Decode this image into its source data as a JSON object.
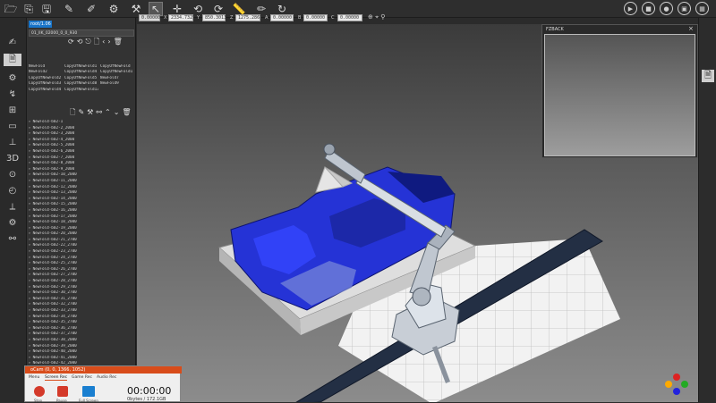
{
  "toolbar": {
    "left_icons": [
      "folder-icon",
      "open-icon",
      "save-icon",
      "tool-edit-icon",
      "tool-teach-icon",
      "robot-link-icon",
      "robot-joint-icon",
      "pointer-icon",
      "move-cross-icon",
      "rotate-icon",
      "rotate-cw-icon",
      "ruler-icon",
      "pencil-icon",
      "cycle-icon"
    ],
    "right_icons": [
      "play-icon",
      "stop-icon",
      "record-icon",
      "cell-icon",
      "grid-icon"
    ],
    "coords": {
      "v1": "0.00000",
      "v2": "2334.7327",
      "v3": "850.3013",
      "v4": "1275.2867",
      "v5": "0.00000",
      "v6": "0.00000",
      "v7": "0.00000"
    }
  },
  "left_panel": {
    "tab_label": "root/1.06",
    "path_value": "01_IIK_02000_0_0_930",
    "grid_names": [
      "NewFold",
      "CopyOfNewFold1",
      "CopyOfNewFold",
      "NewFold2",
      "CopyOfNewFold4",
      "CopyOfNewFold1",
      "CopyOfNewFold2",
      "CopyOfNewFold5",
      "NewFold7",
      "CopyOfNewFold3",
      "CopyOfNewFold8",
      "NewFold9",
      "CopyOfNewFold4",
      "CopyOfNewFold13"
    ],
    "tree_items": [
      "NewFold-b02-1",
      "NewFold-b02-2_2000",
      "NewFold-b02-3_2000",
      "NewFold-b02-4_2000",
      "NewFold-b02-5_2000",
      "NewFold-b02-6_2000",
      "NewFold-b02-7_2000",
      "NewFold-b02-8_2000",
      "NewFold-b02-9_2000",
      "NewFold-b02-10_2000",
      "NewFold-b02-11_2000",
      "NewFold-b02-12_2000",
      "NewFold-b02-13_2000",
      "NewFold-b02-14_2000",
      "NewFold-b02-15_2000",
      "NewFold-b02-16_2000",
      "NewFold-b02-17_2000",
      "NewFold-b02-18_2000",
      "NewFold-b02-19_2000",
      "NewFold-b02-20_2000",
      "NewFold-b02-21_2700",
      "NewFold-b02-22_2700",
      "NewFold-b02-23_2700",
      "NewFold-b02-24_2700",
      "NewFold-b02-25_2700",
      "NewFold-b02-26_2700",
      "NewFold-b02-27_2700",
      "NewFold-b02-28_2700",
      "NewFold-b02-29_2700",
      "NewFold-b02-30_2700",
      "NewFold-b02-31_2700",
      "NewFold-b02-32_2700",
      "NewFold-b02-33_2700",
      "NewFold-b02-34_2700",
      "NewFold-b02-35_2700",
      "NewFold-b02-36_2700",
      "NewFold-b02-37_2700",
      "NewFold-b02-38_2000",
      "NewFold-b02-39_2000",
      "NewFold-b02-40_2000",
      "NewFold-b02-41_2000",
      "NewFold-b02-42_2000",
      "NewFold-b02-43_2000",
      "NewFold-b02-44_2000",
      "NewFold-b02-45_2000"
    ]
  },
  "preview": {
    "title": "FZBACK"
  },
  "recorder": {
    "title": "oCam (0, 0, 1366, 1052)",
    "tabs": [
      "Menu",
      "Screen Rec",
      "Game Rec",
      "Audio Rec"
    ],
    "buttons": [
      "Stop",
      "Pause",
      "Full Screen"
    ],
    "time": "00:00:00",
    "size": "0bytes / 172.1GB"
  },
  "colors": {
    "accent_blue": "#1874c8",
    "mold_blue": "#2533d6",
    "recorder_title": "#d84c1a",
    "conveyor": "#232f44"
  }
}
